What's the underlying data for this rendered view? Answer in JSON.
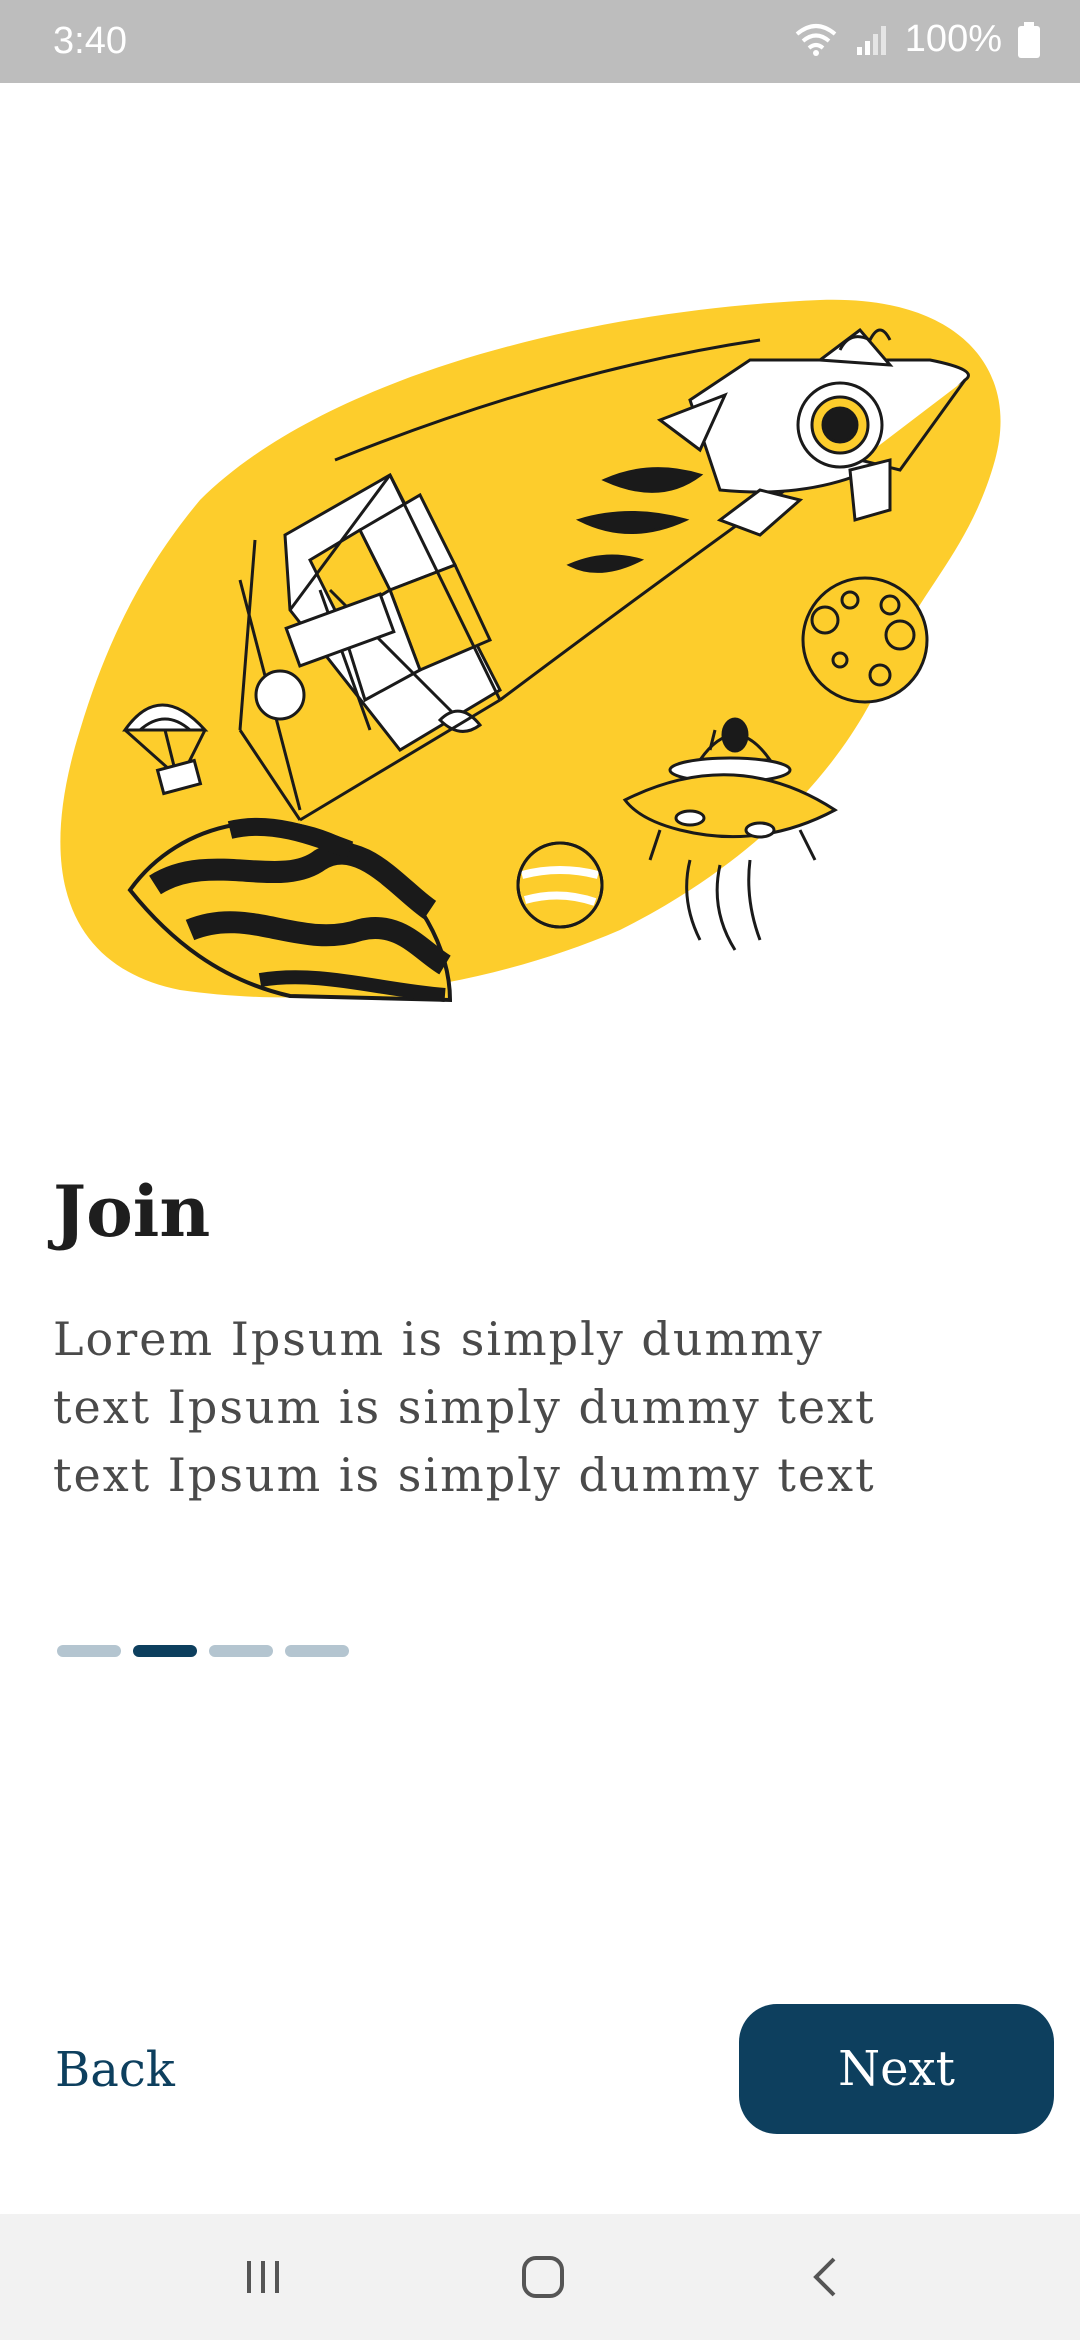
{
  "status_bar": {
    "time": "3:40",
    "battery": "100%",
    "icons": [
      "wifi-icon",
      "signal-icon",
      "battery-icon"
    ]
  },
  "illustration": {
    "icons": [
      "rocket-icon",
      "gift-box-icon",
      "planet-icon",
      "ufo-icon",
      "alien-icon",
      "moon-icon",
      "parachute-icon"
    ],
    "colors": {
      "blob": "#fdcd2c",
      "ink": "#1a1a1a"
    }
  },
  "onboarding": {
    "title": "Join",
    "body_lines": [
      "Lorem Ipsum is simply dummy",
      "text Ipsum is simply dummy text",
      "text Ipsum is simply dummy text"
    ],
    "page_count": 4,
    "current_page": 2
  },
  "actions": {
    "back_label": "Back",
    "next_label": "Next"
  },
  "colors": {
    "primary": "#0d3f5e",
    "indicator_inactive": "#b4c5d0",
    "status_bar": "#bdbdbd",
    "nav_bar": "#f2f2f2"
  },
  "nav_bar": {
    "icons": [
      "recents-icon",
      "home-icon",
      "back-icon"
    ]
  }
}
